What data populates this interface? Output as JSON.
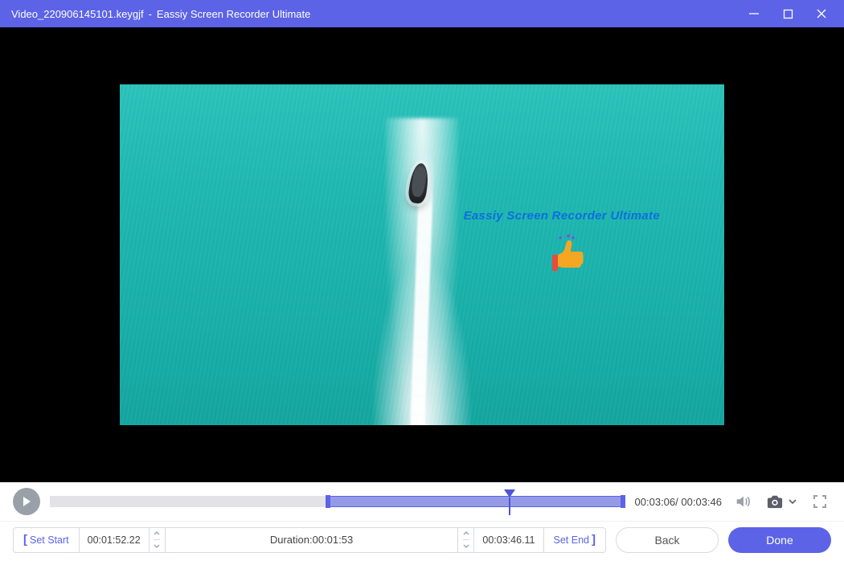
{
  "title": {
    "filename": "Video_220906145101.keygjf",
    "separator": "-",
    "app": "Eassiy Screen Recorder Ultimate"
  },
  "watermark": "Eassiy Screen Recorder Ultimate",
  "player": {
    "current": "00:03:06",
    "total": "00:03:46",
    "time_sep": "/"
  },
  "trim": {
    "set_start_label": "Set Start",
    "set_end_label": "Set End",
    "start_time": "00:01:52.22",
    "end_time": "00:03:46.11",
    "duration_label": "Duration:",
    "duration_value": "00:01:53"
  },
  "buttons": {
    "back": "Back",
    "done": "Done"
  }
}
